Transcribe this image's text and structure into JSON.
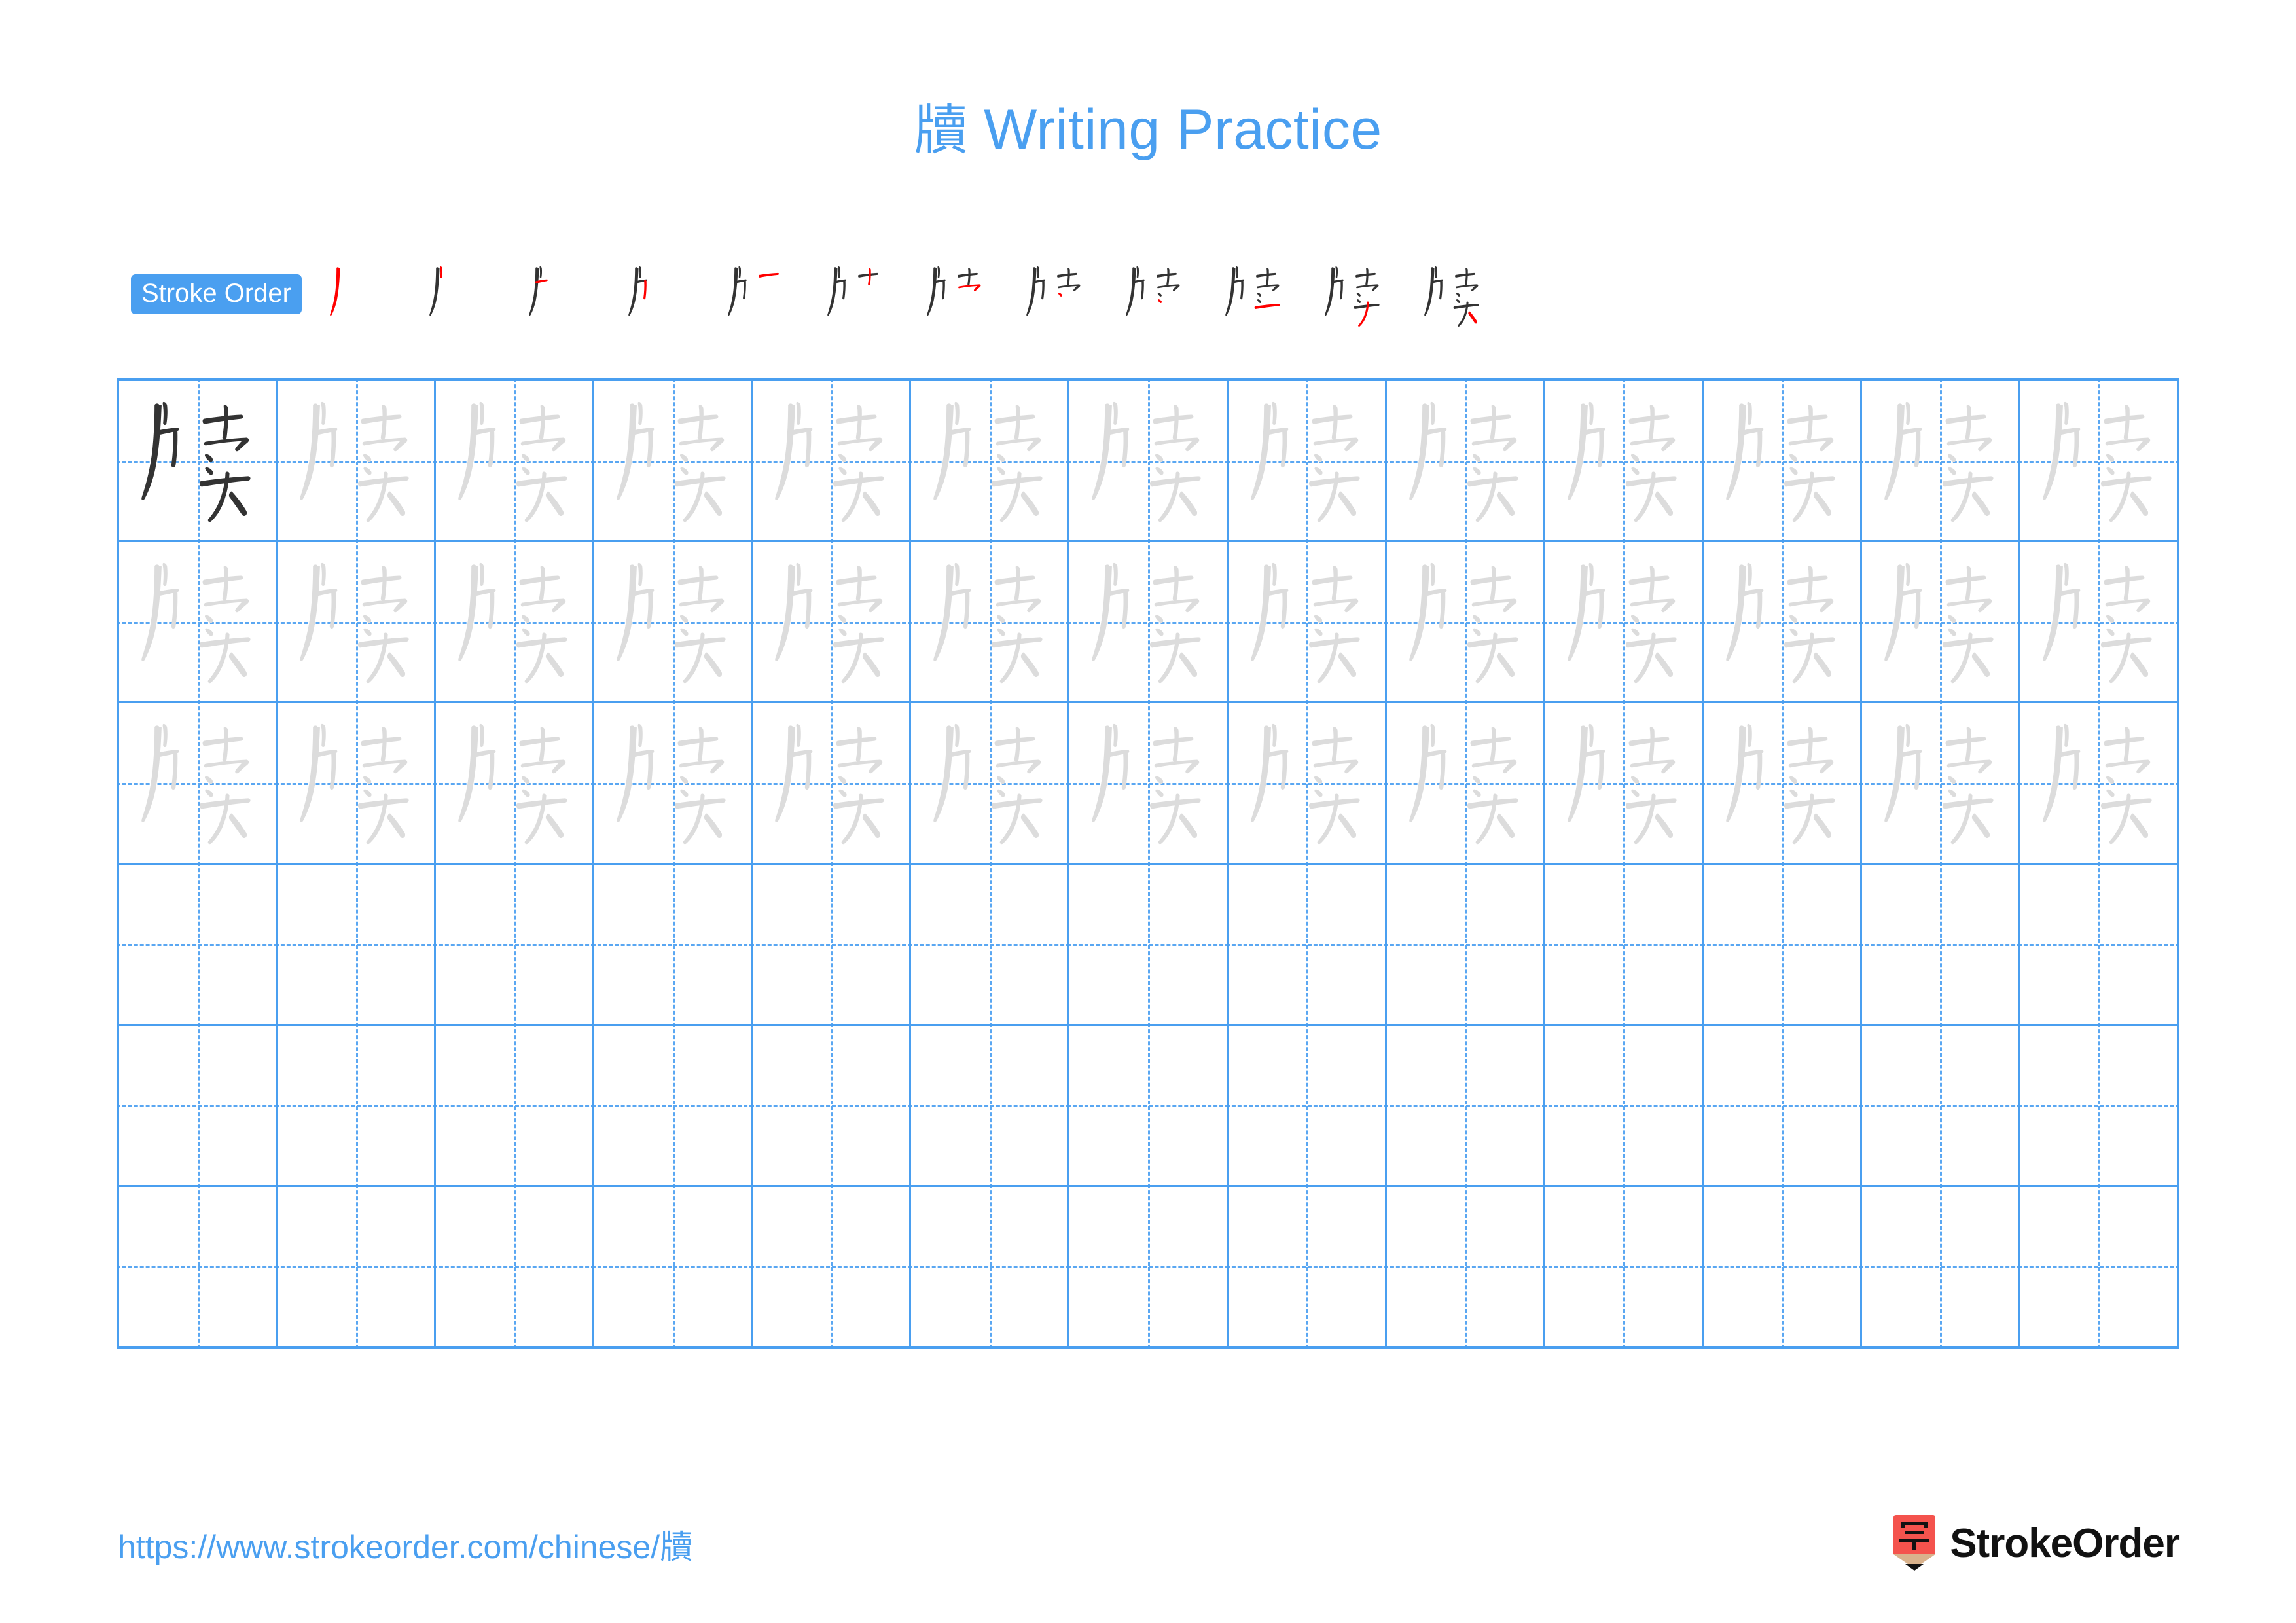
{
  "page": {
    "character": "牘",
    "title_suffix": "Writing Practice",
    "background": "#ffffff",
    "accent_color": "#4a9ff0",
    "stroke_new_color": "#ff0000",
    "stroke_done_color": "#333333",
    "trace_color": "#dcdcdc"
  },
  "stroke_order": {
    "badge_label": "Stroke Order",
    "total_strokes": 12,
    "steps": [
      1,
      2,
      3,
      4,
      5,
      6,
      7,
      8,
      9,
      10,
      11,
      12
    ]
  },
  "grid": {
    "columns": 13,
    "rows": 6,
    "example_cell": {
      "row": 0,
      "col": 0
    },
    "traced_rows": 3,
    "blank_rows": 3,
    "border_color": "#4a9ff0",
    "guide_color": "#5aa7f2"
  },
  "footer": {
    "url": "https://www.strokeorder.com/chinese/牘",
    "brand_name": "StrokeOrder",
    "brand_mark_char": "字",
    "brand_mark_color": "#f4534d",
    "brand_wood_color": "#d9b28c"
  }
}
